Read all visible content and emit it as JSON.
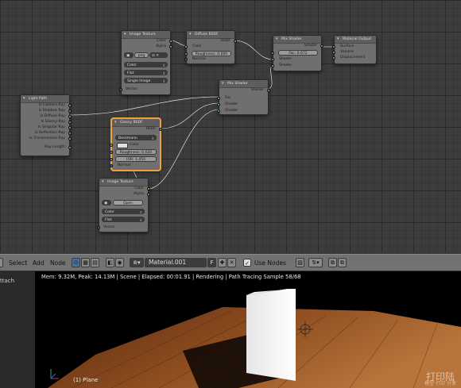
{
  "node_editor": {
    "nodes": {
      "image_texture_top": {
        "title": "Image Texture",
        "outputs": [
          "Color",
          "Alpha"
        ],
        "image_name": "png",
        "color_mode": "Color",
        "projection": "Flat",
        "source": "Single Image",
        "input": "Vector"
      },
      "diffuse": {
        "title": "Diffuse BSDF",
        "output": "BSDF",
        "inputs": [
          "Color",
          "Roughness: 0.000",
          "Normal"
        ]
      },
      "mix_shader_top": {
        "title": "Mix Shader",
        "output": "Shader",
        "fac": "Fac: 0.672",
        "inputs": [
          "Shader",
          "Shader"
        ]
      },
      "material_output": {
        "title": "Material Output",
        "inputs": [
          "Surface",
          "Volume",
          "Displacement"
        ]
      },
      "light_path": {
        "title": "Light Path",
        "outputs": [
          "Is Camera Ray",
          "Is Shadow Ray",
          "Is Diffuse Ray",
          "Is Glossy Ray",
          "Is Singular Ray",
          "Is Reflection Ray",
          "Is Transmission Ray",
          "Ray Length"
        ]
      },
      "mix_shader_mid": {
        "title": "Mix Shader",
        "output": "Shader",
        "inputs": [
          "Fac",
          "Shader",
          "Shader"
        ]
      },
      "glossy": {
        "title": "Glossy BSDF",
        "output": "BSDF",
        "distribution": "Beckmann",
        "color_label": "Color",
        "roughness": "Roughness: 0.020",
        "ior": "IOR: 1.450",
        "normal": "Normal"
      },
      "image_texture_bottom": {
        "title": "Image Texture",
        "outputs": [
          "Color",
          "Alpha"
        ],
        "open_label": "Open",
        "color_mode": "Color",
        "projection": "Flat",
        "input": "Vector"
      }
    }
  },
  "header": {
    "menu": [
      "Select",
      "Add",
      "Node"
    ],
    "material_name": "Material.001",
    "fake_user": "F",
    "use_nodes_label": "Use Nodes"
  },
  "viewport": {
    "sidebar_label": "ttach",
    "status": "Mem: 9.32M, Peak: 14.13M | Scene | Elapsed: 00:01.91 | Rendering | Path Tracing Sample 58/68",
    "object_label": "(1) Plane",
    "watermark": "打印陆",
    "watermark_sub": "模型 打印 分享"
  },
  "colors": {
    "socket_shader": "#63c763",
    "socket_color": "#c7c729",
    "socket_value": "#a1a1a1",
    "socket_vector": "#6363c7",
    "selected_outline": "#f0a040"
  }
}
